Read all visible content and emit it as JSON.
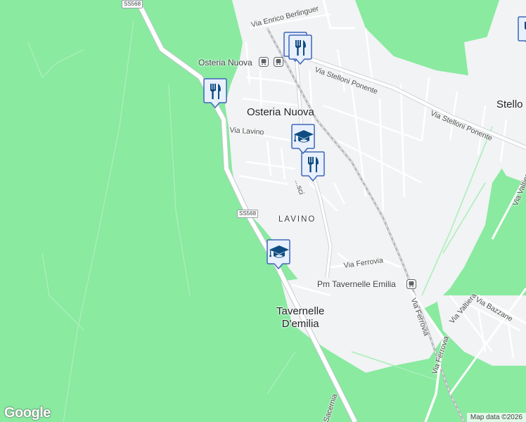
{
  "colors": {
    "water_background": "#89eaa0",
    "land": "#f1f3f4",
    "road": "#ffffff",
    "road_outline": "#c0c4c8",
    "marker_fill": "#e8f0fe",
    "marker_border": "#3d66b8",
    "marker_icon": "#0f4c81"
  },
  "road_shields": [
    "SS568",
    "SS568"
  ],
  "towns": [
    "Osteria Nuova",
    "Tavernelle\nD'emilia",
    "Stello"
  ],
  "area_labels": [
    "LAVINO"
  ],
  "streets": [
    "Via Enrico Berlinguer",
    "Via Stelloni Ponente",
    "Via Stelloni Ponente",
    "Via Lavino",
    "Via Ferrovia",
    "Via Ferrovia",
    "Via Ferrovia",
    "Via Valtiera",
    "Via Bazzane",
    "Via Valtiera",
    "Sacernia",
    "...sci"
  ],
  "stations": [
    "Osteria Nuova",
    "Pm Tavernelle Emilia"
  ],
  "markers": [
    {
      "type": "restaurant",
      "icon": "fork-knife-icon"
    },
    {
      "type": "restaurant",
      "icon": "fork-knife-icon"
    },
    {
      "type": "restaurant",
      "icon": "fork-knife-icon"
    },
    {
      "type": "restaurant",
      "icon": "fork-knife-icon"
    },
    {
      "type": "school",
      "icon": "graduation-cap-icon"
    },
    {
      "type": "school",
      "icon": "graduation-cap-icon"
    }
  ],
  "branding": {
    "logo": "Google"
  },
  "attribution": "Map data ©2026"
}
